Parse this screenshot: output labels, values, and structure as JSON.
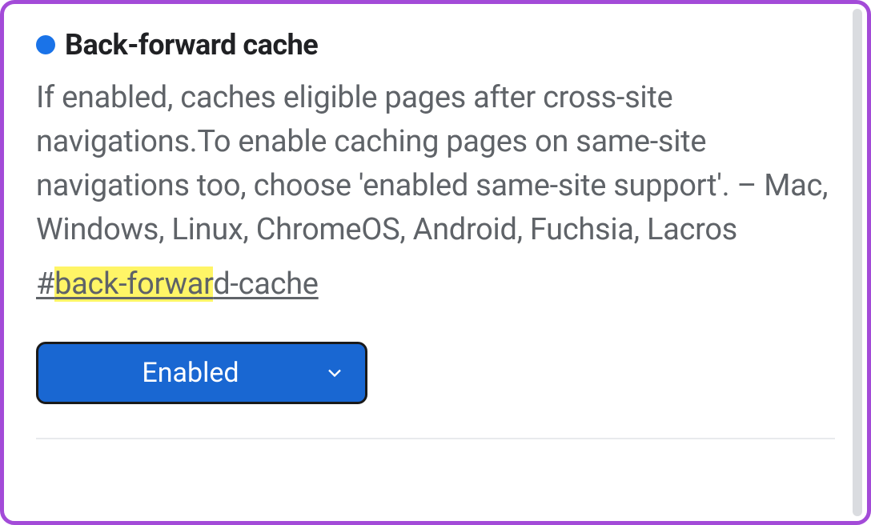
{
  "flag": {
    "title": "Back-forward cache",
    "description": "If enabled, caches eligible pages after cross-site navigations.To enable caching pages on same-site navigations too, choose 'enabled same-site support'. – Mac, Windows, Linux, ChromeOS, Android, Fuchsia, Lacros",
    "anchor_prefix": "#",
    "anchor_highlighted": "back-forwar",
    "anchor_suffix": "d-cache",
    "status_color": "#1a73e8"
  },
  "dropdown": {
    "selected": "Enabled"
  },
  "colors": {
    "frame_border": "#a34bd8",
    "accent": "#1967d2",
    "highlight": "#fff566"
  }
}
